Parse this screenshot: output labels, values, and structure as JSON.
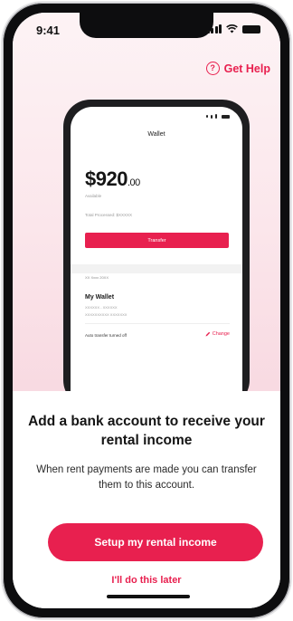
{
  "status_bar": {
    "time": "9:41"
  },
  "header": {
    "help_label": "Get Help",
    "help_icon": "?"
  },
  "preview": {
    "title": "Wallet",
    "balance_main": "$920",
    "balance_cents": ".00",
    "balance_caption": "Available",
    "total_caption": "Total Processed: $XXXXX",
    "transfer_label": "Transfer",
    "date_label": "XX Xxxx 20XX",
    "wallet_name": "My Wallet",
    "wallet_line1": "XXXXXX - XXXXXX",
    "wallet_line2": "XXXXXXXXXX XXXXXXX",
    "auto_transfer": "Auto transfer turned off",
    "change_label": "Change"
  },
  "sheet": {
    "title": "Add a bank account to receive your rental income",
    "body": "When rent payments are made you can transfer them to this account.",
    "primary_button": "Setup my rental income",
    "secondary_link": "I'll do this later"
  },
  "colors": {
    "accent": "#e8204f",
    "background_tint": "#fbe6eb"
  }
}
